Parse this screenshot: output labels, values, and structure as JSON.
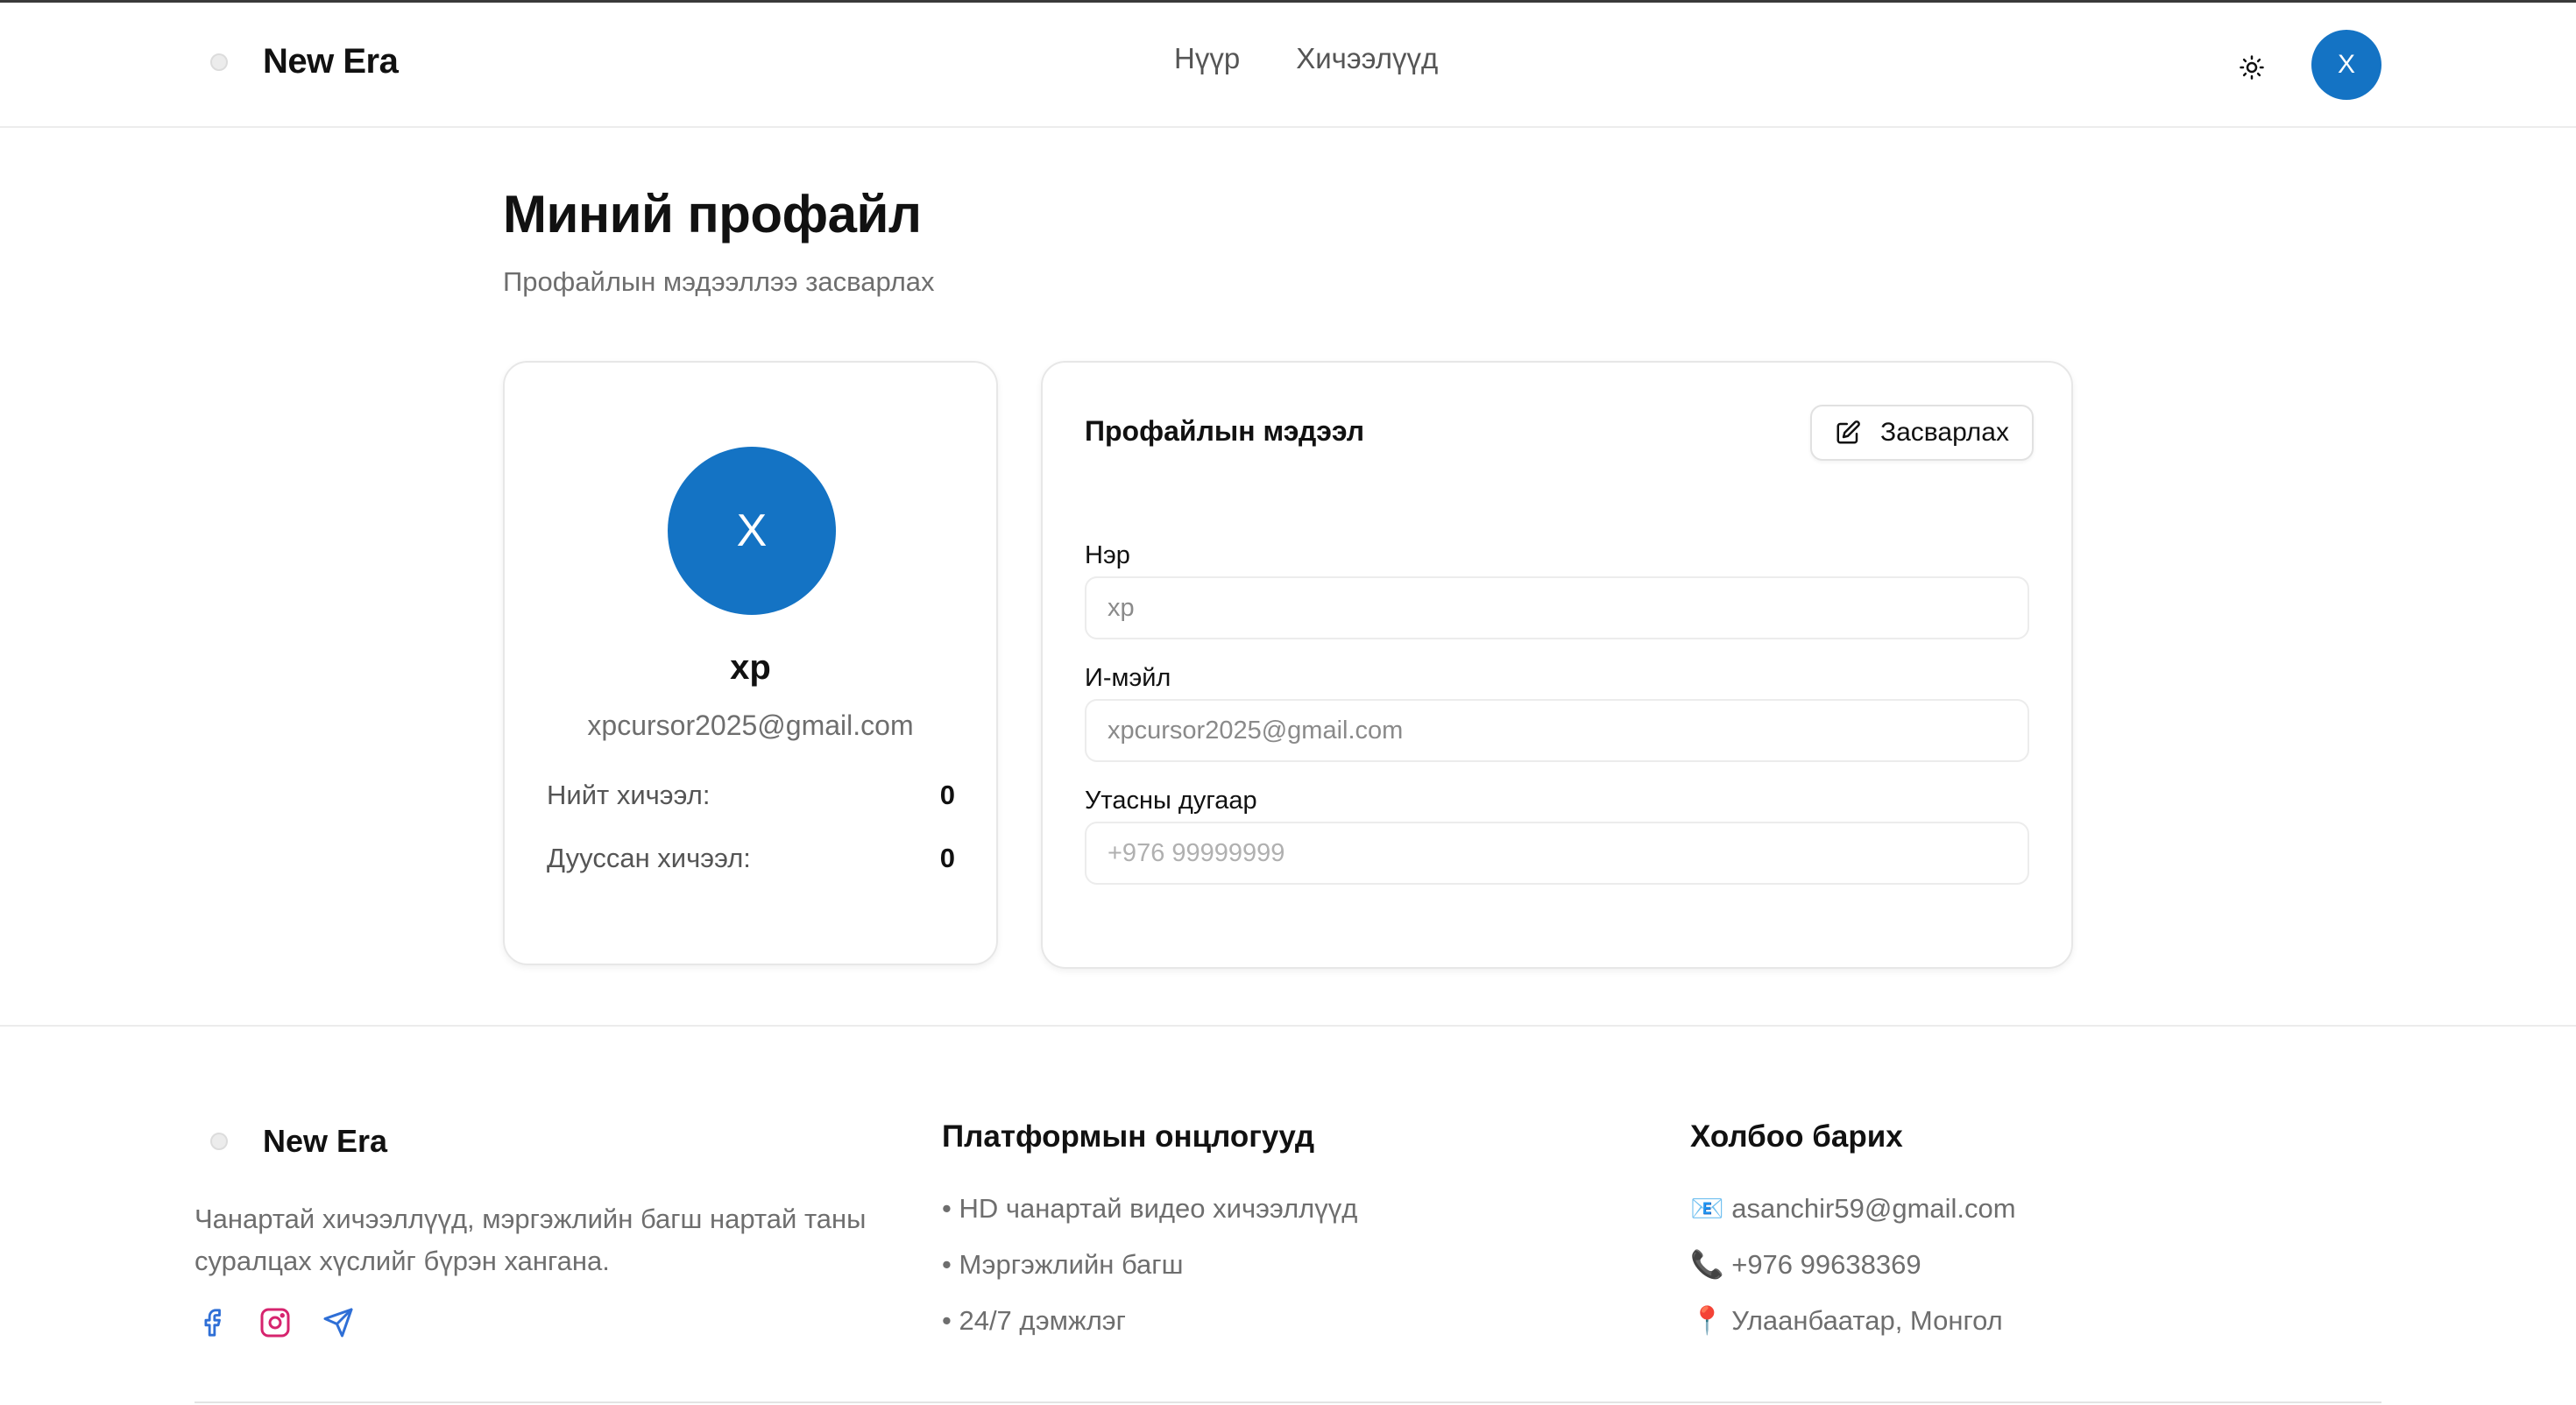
{
  "header": {
    "brand": "New Era",
    "nav": [
      {
        "label": "Нүүр"
      },
      {
        "label": "Хичээлүүд"
      }
    ],
    "avatar_letter": "X"
  },
  "main": {
    "title": "Миний профайл",
    "subtitle": "Профайлын мэдээллээ засварлах",
    "profile_card": {
      "avatar_letter": "X",
      "name": "xp",
      "email": "xpcursor2025@gmail.com",
      "stats": [
        {
          "label": "Нийт хичээл:",
          "value": "0"
        },
        {
          "label": "Дууссан хичээл:",
          "value": "0"
        }
      ]
    },
    "info_card": {
      "title": "Профайлын мэдээл",
      "edit_label": "Засварлах",
      "fields": [
        {
          "label": "Нэр",
          "value": "xp",
          "placeholder": ""
        },
        {
          "label": "И-мэйл",
          "value": "xpcursor2025@gmail.com",
          "placeholder": ""
        },
        {
          "label": "Утасны дугаар",
          "value": "",
          "placeholder": "+976 99999999"
        }
      ]
    }
  },
  "footer": {
    "brand": "New Era",
    "description": "Чанартай хичээллүүд, мэргэжлийн багш нартай таны суралцах хүслийг бүрэн хангана.",
    "socials": [
      "facebook-icon",
      "instagram-icon",
      "telegram-icon"
    ],
    "features": {
      "title": "Платформын онцлогууд",
      "items": [
        "• HD чанартай видео хичээллүүд",
        "• Мэргэжлийн багш",
        "• 24/7 дэмжлэг"
      ]
    },
    "contact": {
      "title": "Холбоо барих",
      "items": [
        "📧 asanchir59@gmail.com",
        "📞 +976 99638369",
        "📍 Улаанбаатар, Монгол"
      ]
    }
  },
  "colors": {
    "accent": "#1473c4",
    "muted_text": "#6e6e6e",
    "border": "#e7e7e7"
  }
}
